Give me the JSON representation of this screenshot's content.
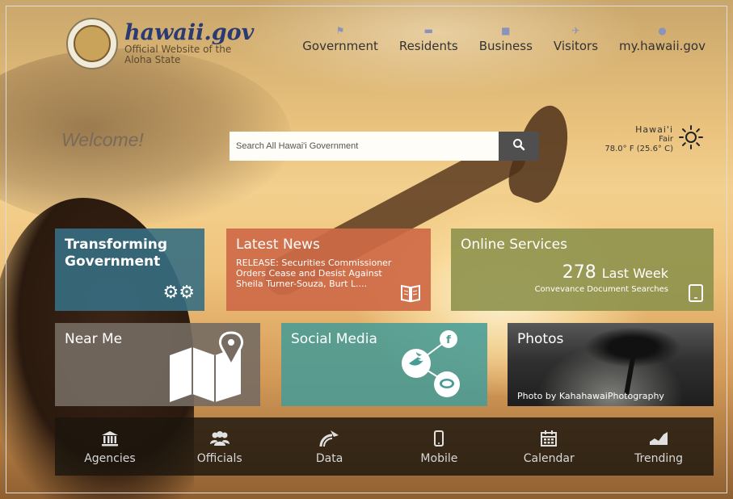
{
  "brand": {
    "title": "hawaii.gov",
    "subtitle_line1": "Official Website of the",
    "subtitle_line2": "Aloha State"
  },
  "nav": [
    {
      "label": "Government",
      "icon": "flag-icon"
    },
    {
      "label": "Residents",
      "icon": "sofa-icon"
    },
    {
      "label": "Business",
      "icon": "briefcase-icon"
    },
    {
      "label": "Visitors",
      "icon": "airplane-icon"
    },
    {
      "label": "my.hawaii.gov",
      "icon": "user-icon"
    }
  ],
  "welcome": "Welcome!",
  "search": {
    "placeholder": "Search All Hawai'i Government",
    "button_icon": "search-icon"
  },
  "weather": {
    "location": "Hawai'i",
    "condition": "Fair",
    "temperature": "78.0° F (25.6° C)",
    "icon": "sun-icon"
  },
  "tiles": {
    "transforming": {
      "title_line1": "Transforming",
      "title_line2": "Government",
      "icon": "gears-icon",
      "color": "#366e82"
    },
    "news": {
      "title": "Latest News",
      "body": "RELEASE: Securities Commissioner Orders Cease and Desist Against Sheila Turner-Souza, Burt L....",
      "icon": "book-icon",
      "color": "#ce6a48"
    },
    "services": {
      "title": "Online Services",
      "count": "278",
      "count_suffix": "Last Week",
      "description": "Convevance Document Searches",
      "icon": "tablet-icon",
      "color": "#8e924c"
    },
    "near_me": {
      "title": "Near Me",
      "icon": "map-pin-icon",
      "color": "#766c62"
    },
    "social": {
      "title": "Social Media",
      "icons": [
        "facebook-icon",
        "twitter-icon",
        "chat-icon"
      ],
      "color": "#489c96"
    },
    "photos": {
      "title": "Photos",
      "credit": "Photo by KahahawaiPhotography"
    }
  },
  "bottom_nav": [
    {
      "label": "Agencies",
      "icon": "building-icon"
    },
    {
      "label": "Officials",
      "icon": "people-icon"
    },
    {
      "label": "Data",
      "icon": "data-icon"
    },
    {
      "label": "Mobile",
      "icon": "phone-icon"
    },
    {
      "label": "Calendar",
      "icon": "calendar-icon"
    },
    {
      "label": "Trending",
      "icon": "trending-icon"
    }
  ]
}
